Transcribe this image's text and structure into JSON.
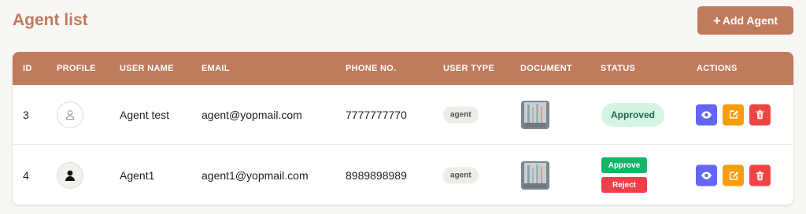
{
  "page": {
    "title": "Agent list",
    "add_button_label": "Add Agent"
  },
  "colors": {
    "brand": "#c07a5c",
    "approved_bg": "#d5f5e3",
    "approve_btn": "#16b46a",
    "reject_btn": "#ef3f4a",
    "view_btn": "#6366f1",
    "edit_btn": "#f59e0b",
    "delete_btn": "#ef4444"
  },
  "table": {
    "headers": {
      "id": "ID",
      "profile": "PROFILE",
      "user_name": "USER NAME",
      "email": "EMAIL",
      "phone": "PHONE NO.",
      "user_type": "USER TYPE",
      "document": "DOCUMENT",
      "status": "STATUS",
      "actions": "ACTIONS"
    },
    "rows": [
      {
        "id": "3",
        "profile_icon": "user-outline-icon",
        "user_name": "Agent test",
        "email": "agent@yopmail.com",
        "phone": "7777777770",
        "user_type": "agent",
        "status": "Approved"
      },
      {
        "id": "4",
        "profile_icon": "user-filled-icon",
        "user_name": "Agent1",
        "email": "agent1@yopmail.com",
        "phone": "8989898989",
        "user_type": "agent",
        "approve_label": "Approve",
        "reject_label": "Reject"
      }
    ]
  },
  "icons": {
    "view": "eye-icon",
    "edit": "edit-icon",
    "delete": "trash-icon",
    "add": "plus-icon"
  }
}
